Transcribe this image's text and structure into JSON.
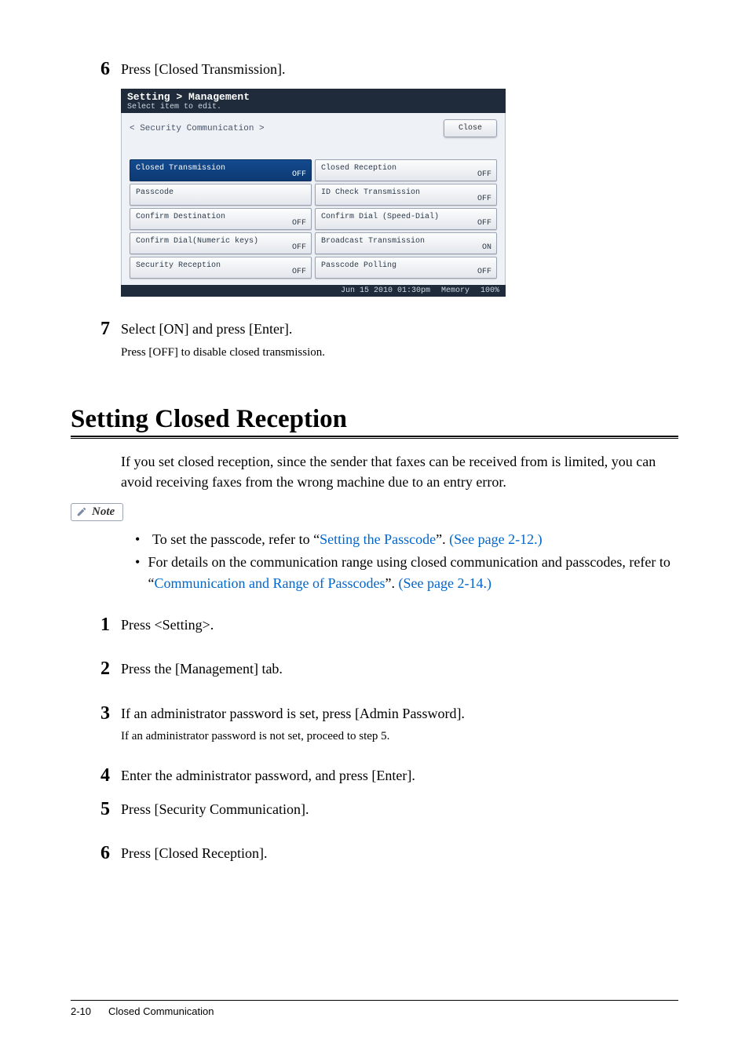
{
  "step6": {
    "num": "6",
    "text": "Press [Closed Transmission]."
  },
  "screenshot": {
    "title_line1": "Setting > Management",
    "title_line2": "Select item to edit.",
    "breadcrumb": "< Security Communication  >",
    "close_label": "Close",
    "items": [
      {
        "label": "Closed Transmission",
        "state": "OFF",
        "selected": true
      },
      {
        "label": "Closed Reception",
        "state": "OFF",
        "selected": false
      },
      {
        "label": "Passcode",
        "state": "",
        "selected": false
      },
      {
        "label": "ID Check Transmission",
        "state": "OFF",
        "selected": false
      },
      {
        "label": "Confirm Destination",
        "state": "OFF",
        "selected": false
      },
      {
        "label": "Confirm Dial (Speed-Dial)",
        "state": "OFF",
        "selected": false
      },
      {
        "label": "Confirm Dial(Numeric keys)",
        "state": "OFF",
        "selected": false
      },
      {
        "label": "Broadcast Transmission",
        "state": "ON",
        "selected": false
      },
      {
        "label": "Security Reception",
        "state": "OFF",
        "selected": false
      },
      {
        "label": "Passcode Polling",
        "state": "OFF",
        "selected": false
      }
    ],
    "status_time": "Jun 15 2010 01:30pm",
    "status_mem_label": "Memory",
    "status_mem_val": "100%"
  },
  "step7": {
    "num": "7",
    "text": "Select [ON] and press [Enter].",
    "sub": "Press [OFF] to disable closed transmission."
  },
  "heading": "Setting Closed Reception",
  "intro": "If you set closed reception, since the sender that faxes can be received from is limited, you can avoid receiving faxes from the wrong machine due to an entry error.",
  "note_label": "Note",
  "notes": {
    "b1_a": "To set the passcode, refer to “",
    "b1_link1": "Setting the Passcode",
    "b1_b": "”. ",
    "b1_link2": "(See page 2-12.)",
    "b2_a": "For details on the communication range using closed communication and passcodes, refer to “",
    "b2_link1": "Communication and Range of Passcodes",
    "b2_b": "”. ",
    "b2_link2": "(See page 2-14.)"
  },
  "steps": {
    "s1": {
      "num": "1",
      "text": "Press <Setting>."
    },
    "s2": {
      "num": "2",
      "text": "Press the [Management] tab."
    },
    "s3": {
      "num": "3",
      "text": "If an administrator password is set, press [Admin Password].",
      "sub": "If an administrator password is not set, proceed to step 5."
    },
    "s4": {
      "num": "4",
      "text": "Enter the administrator password, and press [Enter]."
    },
    "s5": {
      "num": "5",
      "text": "Press [Security Communication]."
    },
    "s6": {
      "num": "6",
      "text": "Press [Closed Reception]."
    }
  },
  "footer": {
    "page": "2-10",
    "section": "Closed Communication"
  }
}
